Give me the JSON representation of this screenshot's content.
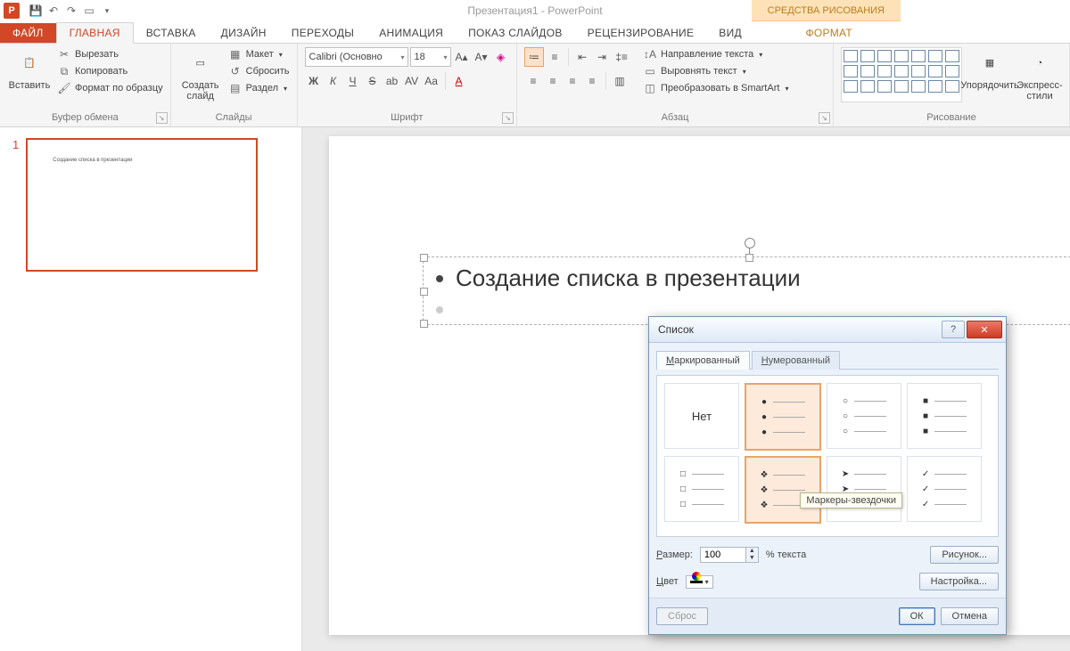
{
  "app": {
    "title": "Презентация1 - PowerPoint",
    "context_tool": "СРЕДСТВА РИСОВАНИЯ"
  },
  "tabs": {
    "file": "ФАЙЛ",
    "home": "ГЛАВНАЯ",
    "insert": "ВСТАВКА",
    "design": "ДИЗАЙН",
    "transitions": "ПЕРЕХОДЫ",
    "animations": "АНИМАЦИЯ",
    "slideshow": "ПОКАЗ СЛАЙДОВ",
    "review": "РЕЦЕНЗИРОВАНИЕ",
    "view": "ВИД",
    "format": "ФОРМАТ"
  },
  "ribbon": {
    "clipboard": {
      "label": "Буфер обмена",
      "paste": "Вставить",
      "cut": "Вырезать",
      "copy": "Копировать",
      "painter": "Формат по образцу"
    },
    "slides": {
      "label": "Слайды",
      "new": "Создать слайд",
      "layout": "Макет",
      "reset": "Сбросить",
      "section": "Раздел"
    },
    "font": {
      "label": "Шрифт",
      "name": "Calibri (Основно",
      "size": "18"
    },
    "paragraph": {
      "label": "Абзац",
      "textdir": "Направление текста",
      "align": "Выровнять текст",
      "smartart": "Преобразовать в SmartArt"
    },
    "drawing": {
      "label": "Рисование",
      "arrange": "Упорядочить",
      "quickstyles": "Экспресс-стили"
    }
  },
  "thumb": {
    "num": "1",
    "text": "Создание списка в презентации"
  },
  "slide": {
    "bullet1": "Создание списка в презентации"
  },
  "dialog": {
    "title": "Список",
    "tab_bulleted_pre": "М",
    "tab_bulleted_rest": "аркированный",
    "tab_numbered_pre": "Н",
    "tab_numbered_rest": "умерованный",
    "none": "Нет",
    "tooltip": "Маркеры-звездочки",
    "size_label_pre": "Р",
    "size_label_rest": "азмер:",
    "size_value": "100",
    "size_unit": "% текста",
    "color_label_pre": "Ц",
    "color_label_rest": "вет",
    "picture_pre": "Р",
    "picture_rest": "исунок...",
    "customize_pre": "Н",
    "customize_rest": "астройка...",
    "reset_pre": "С",
    "reset_rest": "брос",
    "ok": "ОК",
    "cancel": "Отмена"
  }
}
